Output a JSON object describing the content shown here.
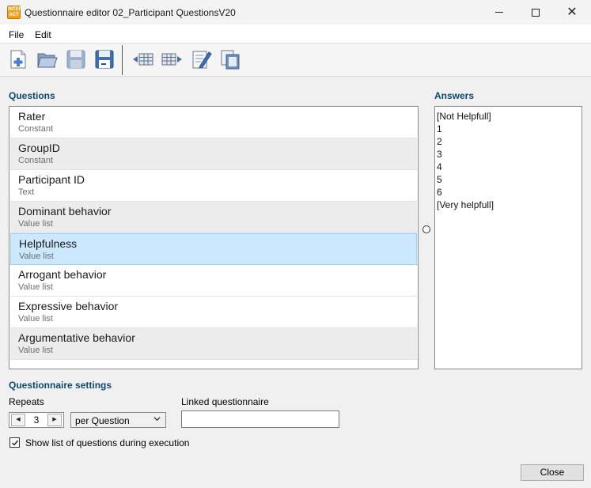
{
  "window": {
    "title": "Questionnaire editor 02_Participant QuestionsV20",
    "app_icon_text": [
      "INTER",
      "ACT"
    ],
    "controls": [
      "minimize-icon",
      "maximize-icon",
      "close-icon"
    ]
  },
  "menu": {
    "items": [
      "File",
      "Edit"
    ]
  },
  "toolbar": {
    "buttons": [
      "new-questionnaire-icon",
      "open-questionnaire-icon",
      "save-icon",
      "save-as-icon",
      "insert-before-icon",
      "insert-after-icon",
      "edit-question-icon",
      "copy-question-icon"
    ]
  },
  "questions": {
    "label": "Questions",
    "items": [
      {
        "name": "Rater",
        "type": "Constant"
      },
      {
        "name": "GroupID",
        "type": "Constant"
      },
      {
        "name": "Participant ID",
        "type": "Text"
      },
      {
        "name": "Dominant behavior",
        "type": "Value list"
      },
      {
        "name": "Helpfulness",
        "type": "Value list",
        "selected": true
      },
      {
        "name": "Arrogant behavior",
        "type": "Value list"
      },
      {
        "name": "Expressive behavior",
        "type": "Value list"
      },
      {
        "name": "Argumentative behavior",
        "type": "Value list"
      }
    ]
  },
  "answers": {
    "label": "Answers",
    "items": [
      "[Not Helpfull]",
      "1",
      "2",
      "3",
      "4",
      "5",
      "6",
      "[Very helpfull]"
    ]
  },
  "settings": {
    "label": "Questionnaire settings",
    "repeats_label": "Repeats",
    "repeats_value": "3",
    "repeat_mode": "per Question",
    "linked_label": "Linked questionnaire",
    "linked_value": "",
    "show_list_label": "Show list of questions during execution",
    "show_list_checked": true
  },
  "footer": {
    "close_label": "Close"
  },
  "colors": {
    "section_label": "#0d4a70",
    "selection": "#cce8ff",
    "selection_border": "#99d1ff",
    "app_icon": "#f0a21b"
  }
}
